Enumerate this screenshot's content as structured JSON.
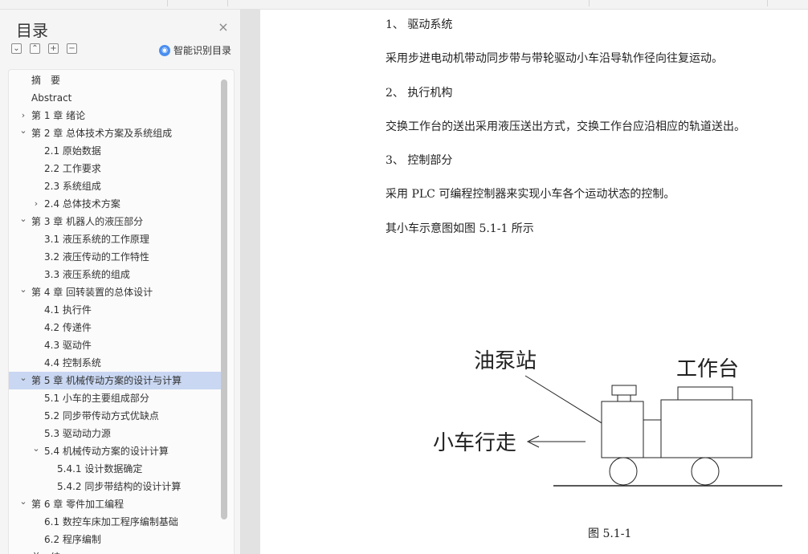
{
  "sidebar": {
    "title": "目录",
    "close_icon": "close-icon",
    "tools": [
      "collapse-all-icon",
      "expand-all-icon",
      "add-heading-icon",
      "remove-heading-icon"
    ],
    "smart_label": "智能识别目录",
    "toc": [
      {
        "label": "摘　要",
        "level": 0,
        "chevron": ""
      },
      {
        "label": "Abstract",
        "level": 0,
        "chevron": ""
      },
      {
        "label": "第 1 章  绪论",
        "level": 0,
        "chevron": "right"
      },
      {
        "label": "第 2 章  总体技术方案及系统组成",
        "level": 0,
        "chevron": "down"
      },
      {
        "label": "2.1 原始数据",
        "level": 1,
        "chevron": ""
      },
      {
        "label": "2.2 工作要求",
        "level": 1,
        "chevron": ""
      },
      {
        "label": "2.3 系统组成",
        "level": 1,
        "chevron": ""
      },
      {
        "label": "2.4 总体技术方案",
        "level": 1,
        "chevron": "right"
      },
      {
        "label": "第 3 章  机器人的液压部分",
        "level": 0,
        "chevron": "down"
      },
      {
        "label": "3.1 液压系统的工作原理",
        "level": 1,
        "chevron": ""
      },
      {
        "label": "3.2 液压传动的工作特性",
        "level": 1,
        "chevron": ""
      },
      {
        "label": "3.3 液压系统的组成",
        "level": 1,
        "chevron": ""
      },
      {
        "label": "第 4 章  回转装置的总体设计",
        "level": 0,
        "chevron": "down"
      },
      {
        "label": "4.1 执行件",
        "level": 1,
        "chevron": ""
      },
      {
        "label": "4.2 传递件",
        "level": 1,
        "chevron": ""
      },
      {
        "label": "4.3 驱动件",
        "level": 1,
        "chevron": ""
      },
      {
        "label": "4.4 控制系统",
        "level": 1,
        "chevron": ""
      },
      {
        "label": "第 5 章  机械传动方案的设计与计算",
        "level": 0,
        "chevron": "down",
        "selected": true
      },
      {
        "label": "5.1 小车的主要组成部分",
        "level": 1,
        "chevron": ""
      },
      {
        "label": "5.2 同步带传动方式优缺点",
        "level": 1,
        "chevron": ""
      },
      {
        "label": "5.3 驱动动力源",
        "level": 1,
        "chevron": ""
      },
      {
        "label": "5.4 机械传动方案的设计计算",
        "level": 1,
        "chevron": "down"
      },
      {
        "label": "5.4.1 设计数据确定",
        "level": 2,
        "chevron": ""
      },
      {
        "label": "5.4.2 同步带结构的设计计算",
        "level": 2,
        "chevron": ""
      },
      {
        "label": "第 6 章  零件加工编程",
        "level": 0,
        "chevron": "down"
      },
      {
        "label": "6.1 数控车床加工程序编制基础",
        "level": 1,
        "chevron": ""
      },
      {
        "label": "6.2 程序编制",
        "level": 1,
        "chevron": ""
      },
      {
        "label": "总　结",
        "level": 0,
        "chevron": ""
      }
    ]
  },
  "document": {
    "paragraphs": [
      "1、  驱动系统",
      "采用步进电动机带动同步带与带轮驱动小车沿导轨作径向往复运动。",
      "2、  执行机构",
      "交换工作台的送出采用液压送出方式，交换工作台应沿相应的轨道送出。",
      "3、  控制部分",
      "采用 PLC 可编程控制器来实现小车各个运动状态的控制。",
      "其小车示意图如图 5.1-1 所示"
    ],
    "figure": {
      "label_pump": "油泵站",
      "label_table": "工作台",
      "label_move": "小车行走"
    },
    "caption": "图 5.1-1"
  }
}
